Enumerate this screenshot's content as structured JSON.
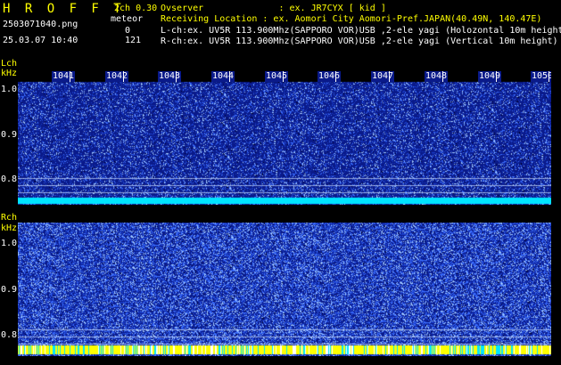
{
  "header": {
    "app_title": "H R O F F T",
    "version": "2ch 0.30",
    "filename": "2503071040.png",
    "datetime": "25.03.07 10:40",
    "meteor_label": "meteor",
    "meteor_count_L": "0",
    "meteor_count_R": "121"
  },
  "info": {
    "observer": "Ovserver              : ex. JR7CYX [ kid ]",
    "location": "Receiving Location : ex. Aomori City Aomori-Pref.JAPAN(40.49N, 140.47E)",
    "lch": "L-ch:ex. UV5R 113.900Mhz(SAPPORO VOR)USB ,2-ele yagi (Holozontal 10m height)",
    "rch": "R-ch:ex. UV5R 113.900Mhz(SAPPORO VOR)USB ,2-ele yagi (Vertical 10m height)"
  },
  "lch_panel": {
    "channel_label": "Lch",
    "unit_label": "kHz",
    "y_ticks": [
      "1.0",
      "0.9",
      "0.8"
    ],
    "x_ticks": [
      "1041",
      "1042",
      "1043",
      "1044",
      "1045",
      "1046",
      "1047",
      "1048",
      "1049",
      "1050"
    ]
  },
  "rch_panel": {
    "channel_label": "Rch",
    "unit_label": "kHz",
    "y_ticks": [
      "1.0",
      "0.9",
      "0.8"
    ]
  },
  "colors": {
    "background": "#000000",
    "noise_base": "#0a1a8a",
    "noise_hi": "#3a6cff",
    "cyan_band": "#00e5ff",
    "yellow_band": "#ffff00",
    "label_yellow": "#ffff00"
  }
}
